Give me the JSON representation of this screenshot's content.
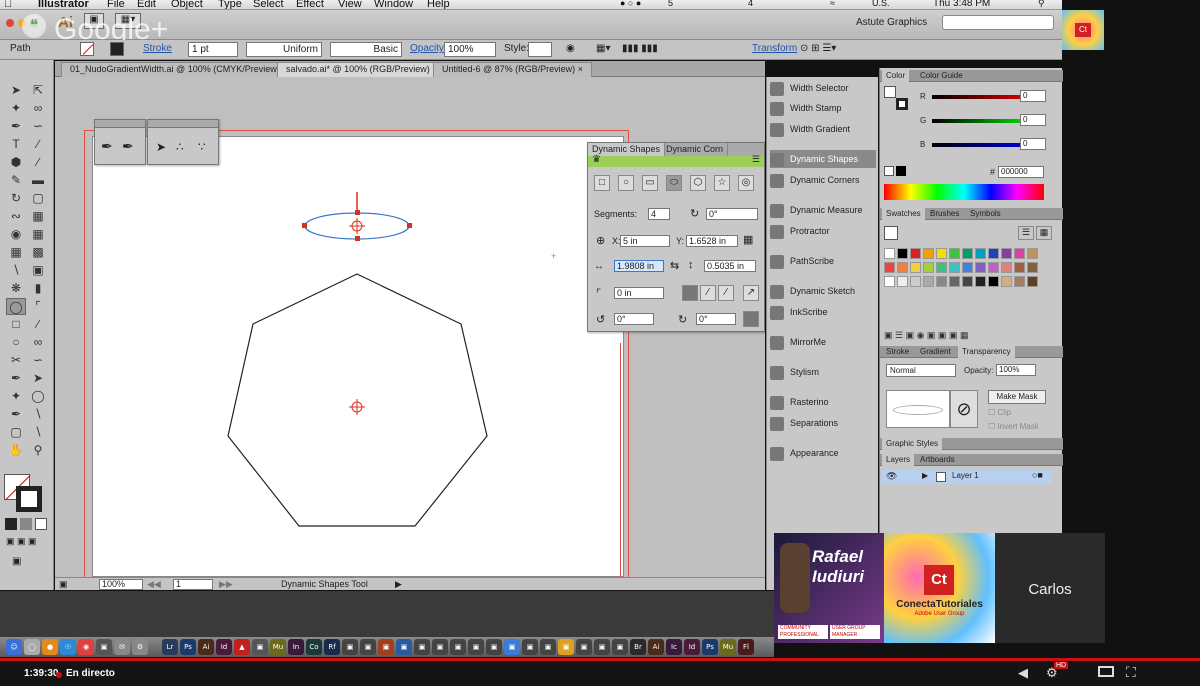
{
  "menubar": {
    "app": "Illustrator",
    "items": [
      "File",
      "Edit",
      "Object",
      "Type",
      "Select",
      "Effect",
      "View",
      "Window",
      "Help"
    ],
    "status_left": "5",
    "status_mid": "4",
    "locale": "U.S.",
    "clock": "Thu 3:48 PM"
  },
  "appbar": {
    "logo": "Ai",
    "watermark": "Google+",
    "workspace": "Astute Graphics",
    "search_placeholder": ""
  },
  "control": {
    "path_label": "Path",
    "stroke_label": "Stroke",
    "stroke_value": "1 pt",
    "profile": "Uniform",
    "brush": "Basic",
    "opacity_label": "Opacity:",
    "opacity_value": "100%",
    "style_label": "Style:",
    "transform_link": "Transform"
  },
  "tabs": [
    {
      "label": "01_NudoGradientWidth.ai @ 100% (CMYK/Preview)",
      "active": false
    },
    {
      "label": "salvado.ai* @ 100% (RGB/Preview)",
      "active": true
    },
    {
      "label": "Untitled-6 @ 87% (RGB/Preview)",
      "active": false
    }
  ],
  "status": {
    "zoom": "100%",
    "page": "1",
    "tool": "Dynamic Shapes Tool"
  },
  "dynamic_shapes": {
    "tab1": "Dynamic Shapes",
    "tab2": "Dynamic Corn",
    "segments_label": "Segments:",
    "segments_value": "4",
    "rotation_value": "0°",
    "x_label": "X:",
    "x_value": "5 in",
    "y_label": "Y:",
    "y_value": "1.6528 in",
    "width_value": "1.9808 in",
    "height_value": "0.5035 in",
    "corner_value": "0 in",
    "angle1": "0°",
    "angle2": "0°"
  },
  "plugins": [
    {
      "label": "Width Selector",
      "selected": false
    },
    {
      "label": "Width Stamp",
      "selected": false
    },
    {
      "label": "Width Gradient",
      "selected": false
    },
    {
      "label": "Dynamic Shapes",
      "selected": true
    },
    {
      "label": "Dynamic Corners",
      "selected": false
    },
    {
      "label": "Dynamic Measure",
      "selected": false
    },
    {
      "label": "Protractor",
      "selected": false
    },
    {
      "label": "PathScribe",
      "selected": false
    },
    {
      "label": "Dynamic Sketch",
      "selected": false
    },
    {
      "label": "InkScribe",
      "selected": false
    },
    {
      "label": "MirrorMe",
      "selected": false
    },
    {
      "label": "Stylism",
      "selected": false
    },
    {
      "label": "Rasterino",
      "selected": false
    },
    {
      "label": "Separations",
      "selected": false
    },
    {
      "label": "Appearance",
      "selected": false
    }
  ],
  "color_panel": {
    "tab1": "Color",
    "tab2": "Color Guide",
    "r_label": "R",
    "g_label": "G",
    "b_label": "B",
    "r": "0",
    "g": "0",
    "b": "0",
    "hex_label": "#",
    "hex": "000000"
  },
  "swatches_panel": {
    "tab1": "Swatches",
    "tab2": "Brushes",
    "tab3": "Symbols"
  },
  "transparency_panel": {
    "tab1": "Stroke",
    "tab2": "Gradient",
    "tab3": "Transparency",
    "mode": "Normal",
    "opacity_label": "Opacity:",
    "opacity": "100%",
    "make_mask": "Make Mask",
    "clip": "Clip",
    "invert": "Invert Mask"
  },
  "graphic_styles": {
    "tab": "Graphic Styles"
  },
  "layers_panel": {
    "tab1": "Layers",
    "tab2": "Artboards",
    "layer": "Layer 1"
  },
  "tiles": {
    "tile1_text": "Rafael Iudiuri",
    "tile1_badge1": "COMMUNITY PROFESSIONAL",
    "tile1_badge2": "USER GROUP MANAGER",
    "tile2_logo": "Ct",
    "tile2_title": "ConectaTutoriales",
    "tile2_sub": "Adobe User Group",
    "tile3_name": "Carlos"
  },
  "player": {
    "time": "1:39:30",
    "live": "En directo",
    "hd": "HD"
  },
  "dock_icons": [
    "Lr",
    "Ps",
    "Ai",
    "Id",
    "Mu",
    "In",
    "Co",
    "Rf",
    "Br",
    "Ai",
    "Ic",
    "Id",
    "Ps",
    "Mu",
    "Fl"
  ],
  "colors": {
    "selection_blue": "#3a78c8",
    "anchor_red": "#d83020",
    "artboard_border": "#e05040",
    "panel_green": "#9ccf5a",
    "live_red": "#cc1111"
  }
}
